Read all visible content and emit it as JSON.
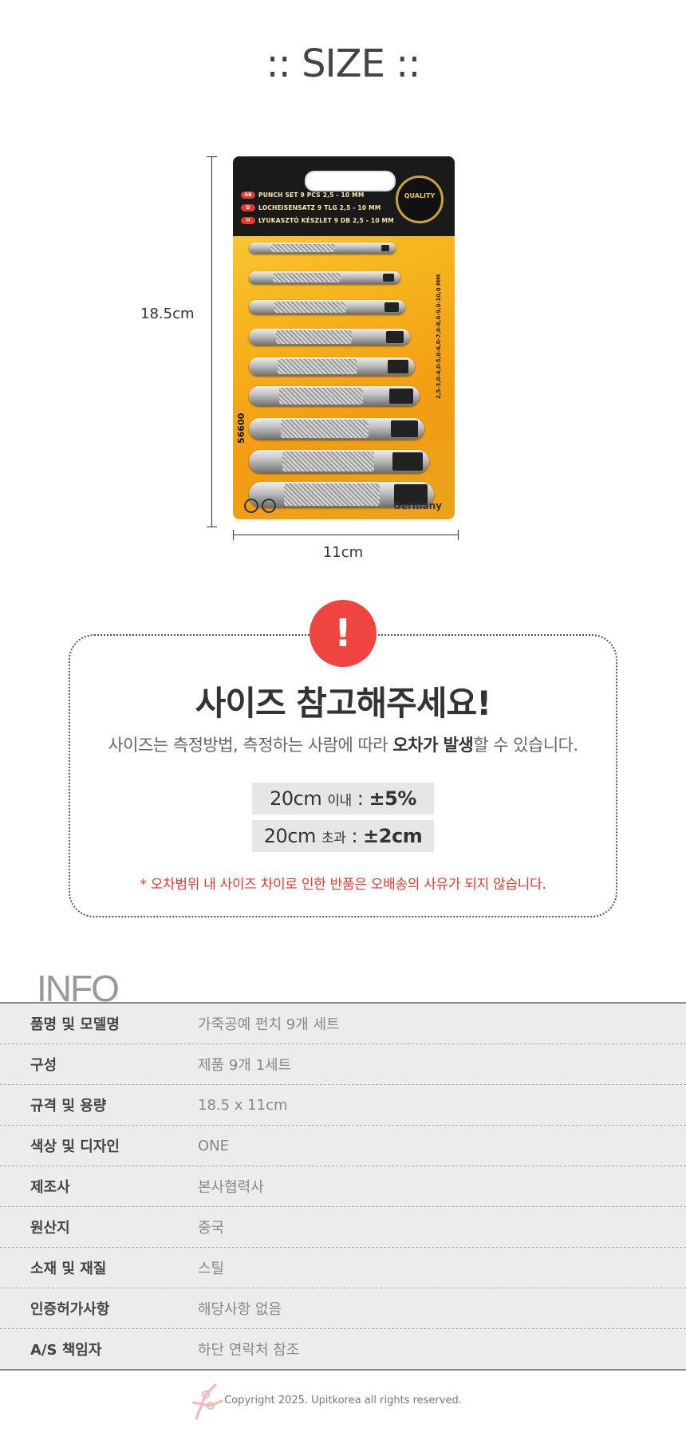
{
  "size_section": {
    "title": ":: SIZE ::",
    "height_label": "18.5cm",
    "width_label": "11cm"
  },
  "product": {
    "header_lines": [
      {
        "flag": "GB",
        "text": "PUNCH SET 9 PCS 2,5 - 10 MM"
      },
      {
        "flag": "D",
        "text": "LOCHEISENSATZ 9 TLG 2,5 - 10 MM"
      },
      {
        "flag": "H",
        "text": "LYUKASZTÓ KÉSZLET 9 DB 2,5 - 10 MM"
      }
    ],
    "seal_text": "QUALITY",
    "code": "56600",
    "size_range": "2,5-3,0-4,0-5,0-6,0-7,0-8,0-9,0-10,0 MM",
    "origin": "Germany",
    "punch_count": 9
  },
  "notice": {
    "icon": "!",
    "title": "사이즈 참고해주세요!",
    "sub_before": "사이즈는 측정방법, 측정하는 사람에 따라 ",
    "sub_bold": "오차가 발생",
    "sub_after": "할 수 있습니다.",
    "tolerances": [
      {
        "size": "20cm",
        "cond": "이내",
        "value": "±5%"
      },
      {
        "size": "20cm",
        "cond": "초과",
        "value": "±2cm"
      }
    ],
    "warning": "* 오차범위 내 사이즈 차이로 인한 반품은 오배송의 사유가 되지 않습니다."
  },
  "info": {
    "title": "INFO",
    "rows": [
      {
        "key": "품명 및 모델명",
        "value": "가죽공예 펀치 9개 세트"
      },
      {
        "key": "구성",
        "value": "제품 9개 1세트"
      },
      {
        "key": "규격 및 용량",
        "value": "18.5 x 11cm"
      },
      {
        "key": "색상 및 디자인",
        "value": "ONE"
      },
      {
        "key": "제조사",
        "value": "본사협력사"
      },
      {
        "key": "원산지",
        "value": "중국"
      },
      {
        "key": "소재 및 재질",
        "value": "스틸"
      },
      {
        "key": "인증허가사항",
        "value": "해당사항  없음"
      },
      {
        "key": "A/S 책임자",
        "value": "하단 연락처 참조"
      }
    ]
  },
  "footer": {
    "copyright": "Copyright 2025. Upitkorea all rights reserved."
  },
  "colors": {
    "accent_red": "#f0453e",
    "warning_red": "#e03a31",
    "table_bg": "#ececec"
  }
}
